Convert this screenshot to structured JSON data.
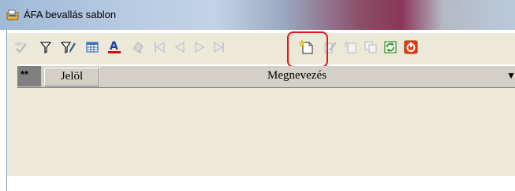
{
  "window": {
    "title": "ÁFA bevallás sablon"
  },
  "toolbar": {
    "buttons": [
      {
        "name": "spellcheck",
        "icon": "spellcheck-icon",
        "enabled": false
      },
      {
        "name": "filter",
        "icon": "filter-icon",
        "enabled": true
      },
      {
        "name": "filter-edit",
        "icon": "filter-edit-icon",
        "enabled": true
      },
      {
        "name": "table",
        "icon": "table-icon",
        "enabled": true
      },
      {
        "name": "font-color",
        "icon": "font-color-icon",
        "enabled": true
      },
      {
        "name": "clear-format",
        "icon": "eraser-icon",
        "enabled": false
      },
      {
        "name": "first",
        "icon": "first-record-icon",
        "enabled": false
      },
      {
        "name": "prev",
        "icon": "previous-record-icon",
        "enabled": false
      },
      {
        "name": "next",
        "icon": "next-record-icon",
        "enabled": false
      },
      {
        "name": "last",
        "icon": "last-record-icon",
        "enabled": false
      },
      {
        "name": "new",
        "icon": "new-document-icon",
        "enabled": true,
        "highlighted": true
      },
      {
        "name": "edit",
        "icon": "edit-icon",
        "enabled": false
      },
      {
        "name": "copy-new",
        "icon": "copy-new-icon",
        "enabled": false
      },
      {
        "name": "copy",
        "icon": "copy-icon",
        "enabled": false
      },
      {
        "name": "refresh",
        "icon": "refresh-icon",
        "enabled": true
      },
      {
        "name": "close",
        "icon": "power-icon",
        "enabled": true
      }
    ],
    "highlight_color": "#e01818"
  },
  "grid": {
    "corner_label": "**",
    "columns": [
      {
        "label": "Jelöl"
      },
      {
        "label": "Megnevezés"
      }
    ],
    "sort_arrow": "▼"
  }
}
